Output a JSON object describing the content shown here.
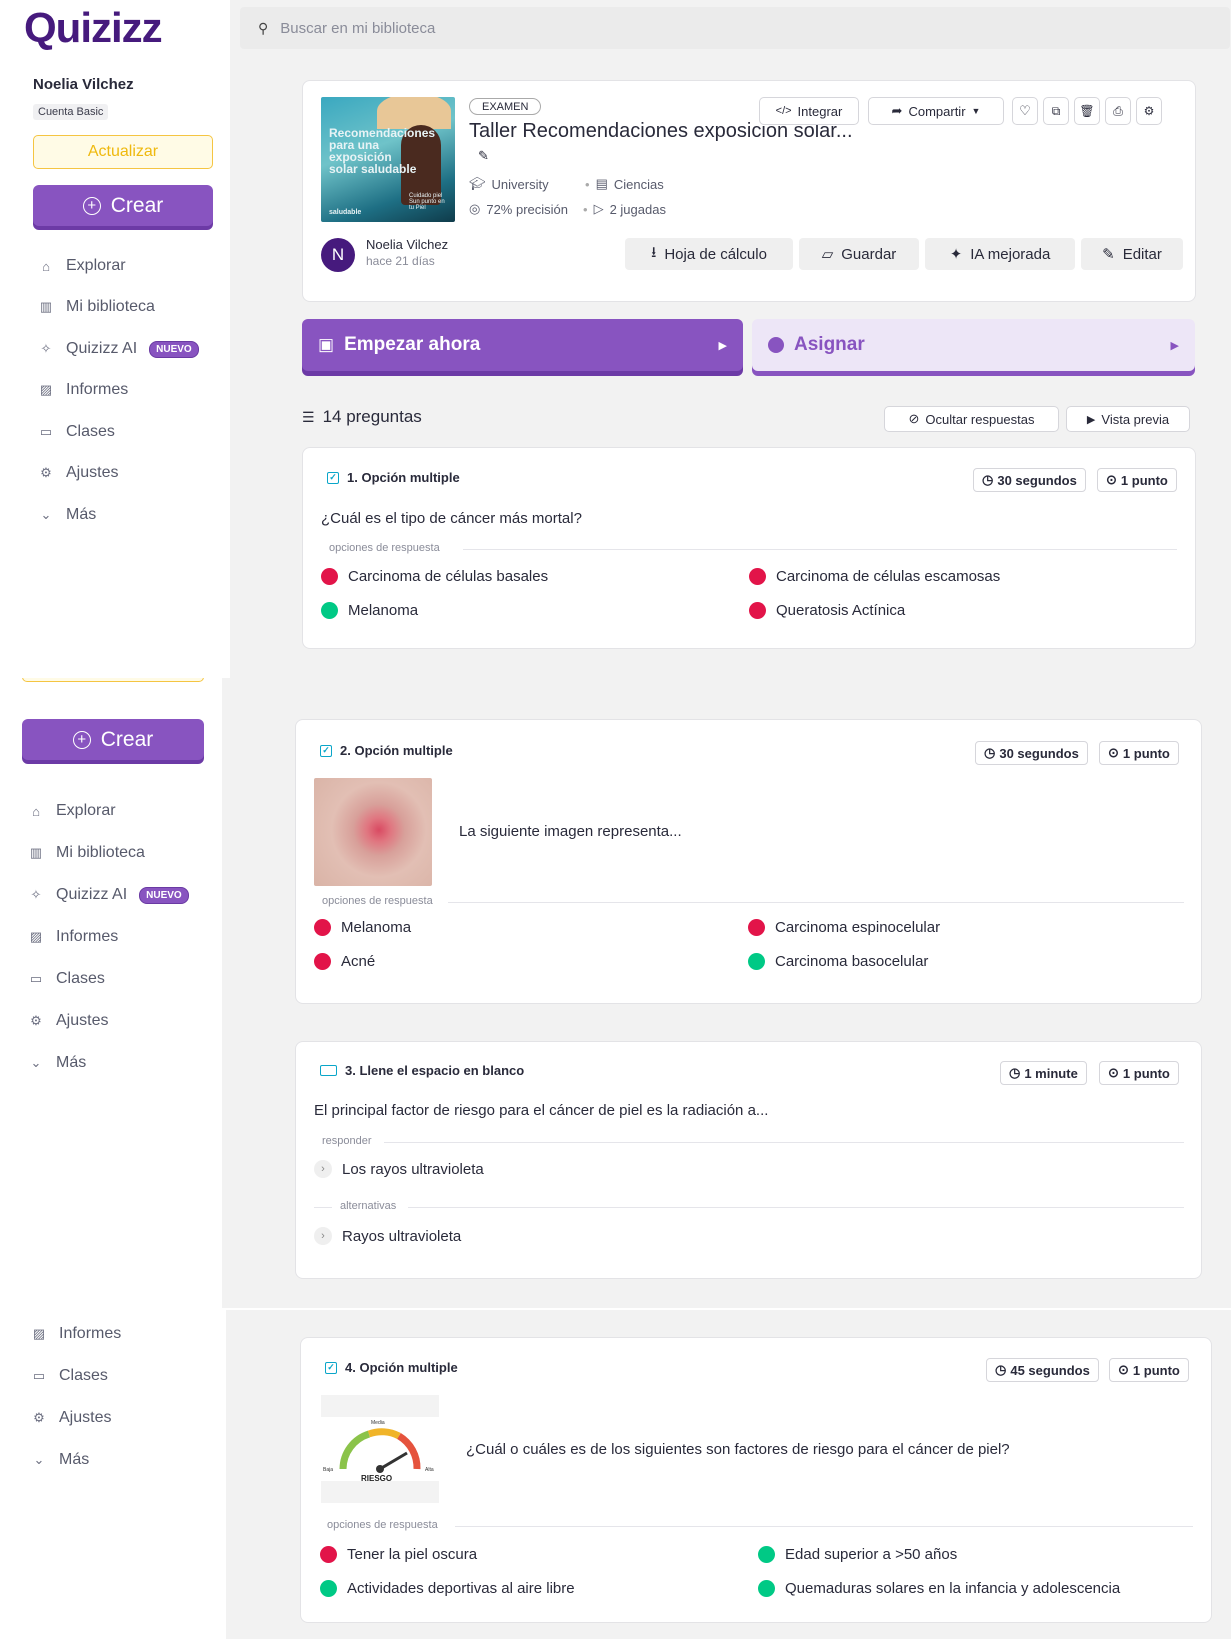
{
  "brand": {
    "logo_text": "Quizizz"
  },
  "search": {
    "placeholder": "Buscar en mi biblioteca"
  },
  "user": {
    "name": "Noelia Vilchez",
    "account": "Cuenta Basic",
    "avatar_initial": "N"
  },
  "sidebar": {
    "upgrade_label": "Actualizar",
    "create_label": "Crear",
    "new_badge": "NUEVO",
    "items": [
      {
        "label": "Explorar",
        "icon": "explore-icon"
      },
      {
        "label": "Mi biblioteca",
        "icon": "library-icon"
      },
      {
        "label": "Quizizz AI",
        "icon": "sparkle-icon"
      },
      {
        "label": "Informes",
        "icon": "reports-icon"
      },
      {
        "label": "Clases",
        "icon": "classes-icon"
      },
      {
        "label": "Ajustes",
        "icon": "settings-icon"
      },
      {
        "label": "Más",
        "icon": "chevron-down-icon"
      }
    ]
  },
  "quiz": {
    "tag": "EXAMEN",
    "title": "Taller Recomendaciones exposición solar...",
    "grade": "University",
    "subject": "Ciencias",
    "accuracy": "72% precisión",
    "plays": "2 jugadas",
    "author": "Noelia Vilchez",
    "created": "hace 21 días",
    "thumb": {
      "title": "Recomendaciones para una exposición solar saludable",
      "small": "Cuidado piel Sun punto en tu Piel",
      "brand": "saludable"
    },
    "toolbar": {
      "integrar": "Integrar",
      "compartir": "Compartir"
    },
    "actions": {
      "spreadsheet": "Hoja de cálculo",
      "save": "Guardar",
      "ai": "IA mejorada",
      "edit": "Editar"
    },
    "start_label": "Empezar ahora",
    "assign_label": "Asignar",
    "question_count": "14 preguntas",
    "hide_answers": "Ocultar respuestas",
    "preview": "Vista previa"
  },
  "labels": {
    "answer_options": "opciones de respuesta",
    "respond": "responder",
    "alternatives": "alternativas"
  },
  "questions": [
    {
      "type": "1. Opción multiple",
      "time": "30 segundos",
      "points": "1 punto",
      "text": "¿Cuál es el tipo de cáncer más mortal?",
      "options": [
        {
          "text": "Carcinoma de células basales",
          "correct": false
        },
        {
          "text": "Carcinoma de células escamosas",
          "correct": false
        },
        {
          "text": "Melanoma",
          "correct": true
        },
        {
          "text": "Queratosis Actínica",
          "correct": false
        }
      ]
    },
    {
      "type": "2. Opción multiple",
      "time": "30 segundos",
      "points": "1 punto",
      "text": "La siguiente imagen representa...",
      "options": [
        {
          "text": "Melanoma",
          "correct": false
        },
        {
          "text": "Carcinoma espinocelular",
          "correct": false
        },
        {
          "text": "Acné",
          "correct": false
        },
        {
          "text": "Carcinoma basocelular",
          "correct": true
        }
      ]
    },
    {
      "type": "3. Llene el espacio en blanco",
      "time": "1 minute",
      "points": "1 punto",
      "text": "El principal factor de riesgo para el cáncer de piel es la radiación a...",
      "answer": "Los rayos ultravioleta",
      "alternative": "Rayos ultravioleta"
    },
    {
      "type": "4. Opción multiple",
      "time": "45 segundos",
      "points": "1 punto",
      "text": "¿Cuál o cuáles es de los siguientes son factores de riesgo para el cáncer de piel?",
      "gauge": {
        "top": "Media",
        "low": "Baja",
        "high": "Alta",
        "caption": "RIESGO"
      },
      "options": [
        {
          "text": "Tener la piel oscura",
          "correct": false
        },
        {
          "text": "Edad superior a >50 años",
          "correct": true
        },
        {
          "text": "Actividades deportivas al aire libre",
          "correct": true
        },
        {
          "text": "Quemaduras solares en la infancia y adolescencia",
          "correct": true
        }
      ]
    }
  ],
  "colors": {
    "primary": "#8854c0",
    "correct": "#00c985",
    "incorrect": "#e21449",
    "upgrade": "#efb90f"
  }
}
